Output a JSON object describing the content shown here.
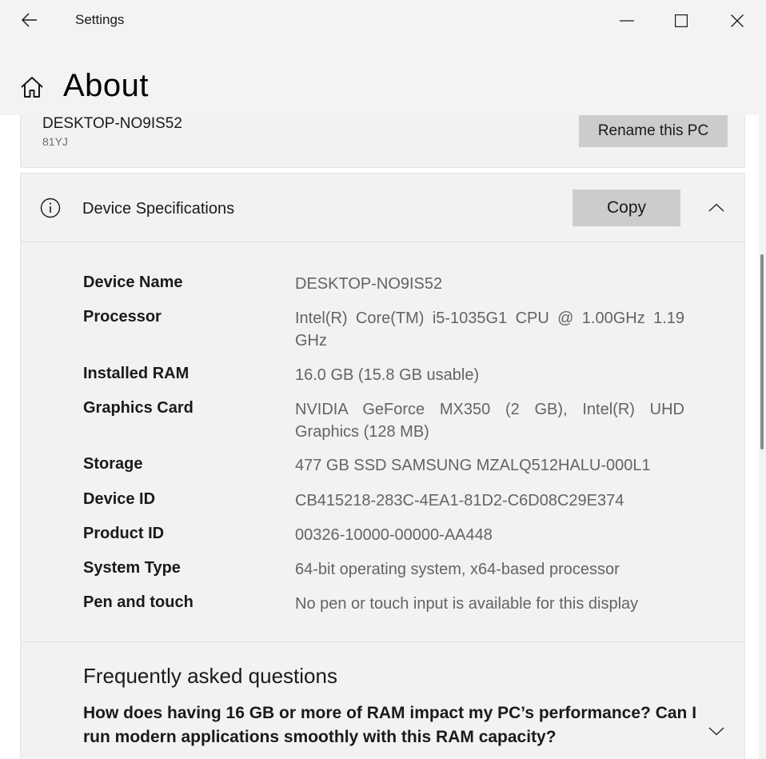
{
  "window": {
    "title": "Settings",
    "back_icon": "arrow-left-icon",
    "minimize_icon": "minimize-icon",
    "maximize_icon": "maximize-icon",
    "close_icon": "close-icon"
  },
  "header": {
    "home_icon": "home-icon",
    "title": "About"
  },
  "pc_card": {
    "name": "DESKTOP-NO9IS52",
    "model": "81YJ",
    "rename_label": "Rename this PC"
  },
  "specs": {
    "icon": "info-icon",
    "title": "Device Specifications",
    "copy_label": "Copy",
    "collapse_icon": "chevron-up-icon",
    "rows": [
      {
        "label": "Device Name",
        "value": "DESKTOP-NO9IS52"
      },
      {
        "label": "Processor",
        "value": "Intel(R) Core(TM) i5-1035G1 CPU @ 1.00GHz   1.19 GHz"
      },
      {
        "label": "Installed RAM",
        "value": "16.0 GB (15.8 GB usable)"
      },
      {
        "label": "Graphics Card",
        "value": "NVIDIA GeForce MX350 (2 GB), Intel(R) UHD Graphics (128 MB)"
      },
      {
        "label": "Storage",
        "value": "477 GB SSD SAMSUNG MZALQ512HALU-000L1"
      },
      {
        "label": "Device ID",
        "value": "CB415218-283C-4EA1-81D2-C6D08C29E374"
      },
      {
        "label": "Product ID",
        "value": "00326-10000-00000-AA448"
      },
      {
        "label": "System Type",
        "value": "64-bit operating system, x64-based processor"
      },
      {
        "label": "Pen and touch",
        "value": "No pen or touch input is available for this display"
      }
    ]
  },
  "faq": {
    "title": "Frequently asked questions",
    "question": "How does having 16 GB or more of RAM impact my PC’s performance? Can I run modern applications smoothly with this RAM capacity?",
    "expand_icon": "chevron-down-icon"
  },
  "colors": {
    "chrome_bg": "#f3f3f3",
    "card_bg": "#f2f2f2",
    "button_bg": "#cccccc",
    "value_text": "#646464"
  }
}
